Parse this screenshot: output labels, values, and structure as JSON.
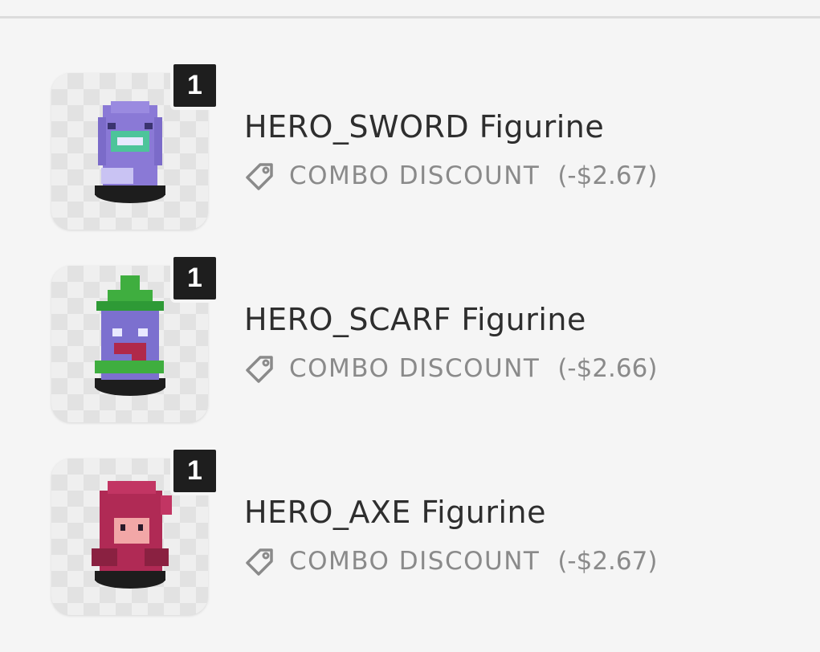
{
  "items": [
    {
      "quantity": "1",
      "name": "HERO_SWORD Figurine",
      "discount_label": "COMBO DISCOUNT",
      "discount_amount": "(-$2.67)",
      "highlighted": false
    },
    {
      "quantity": "1",
      "name": "HERO_SCARF Figurine",
      "discount_label": "COMBO DISCOUNT",
      "discount_amount": "(-$2.66)",
      "highlighted": true
    },
    {
      "quantity": "1",
      "name": "HERO_AXE Figurine",
      "discount_label": "COMBO DISCOUNT",
      "discount_amount": "(-$2.67)",
      "highlighted": false
    }
  ],
  "icons": {
    "tag": "tag-icon"
  },
  "colors": {
    "highlight": "#f1ef2a",
    "badge": "#1e1e1e",
    "text": "#2e2e2e",
    "muted": "#8a8a8a"
  }
}
